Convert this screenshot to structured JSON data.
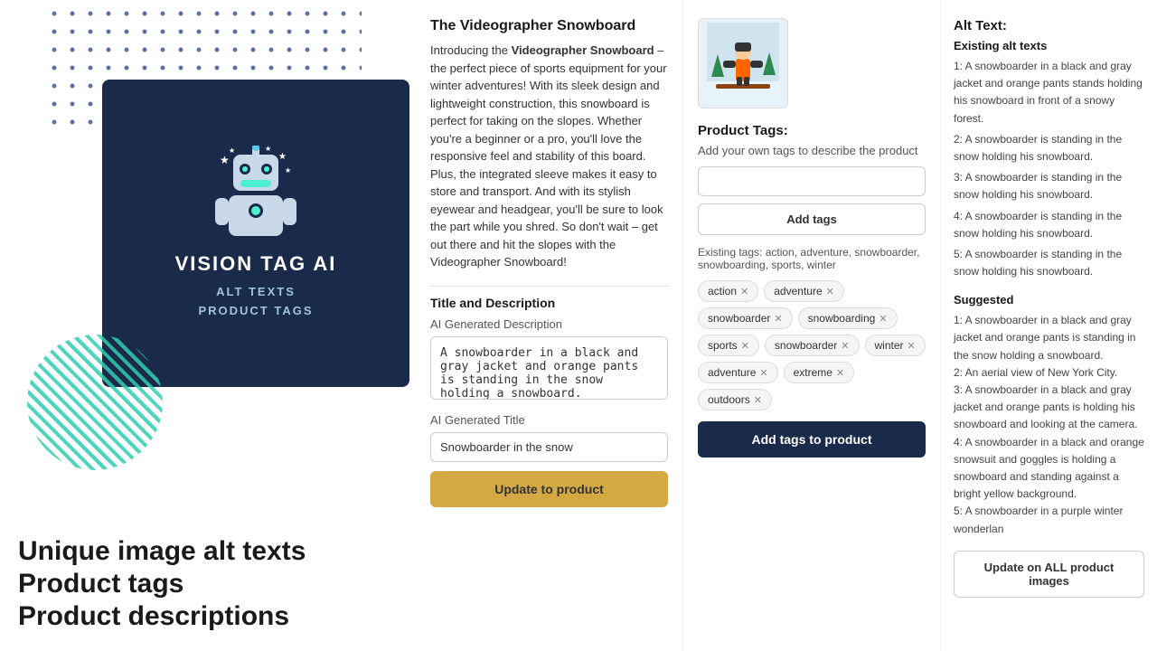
{
  "dots": {
    "color": "#1a2a6c"
  },
  "logo": {
    "title": "VISION TAG AI",
    "subtitle_line1": "ALT TEXTS",
    "subtitle_line2": "PRODUCT TAGS"
  },
  "bottom_text": {
    "line1": "Unique image alt texts",
    "line2": "Product tags",
    "line3": "Product descriptions"
  },
  "product": {
    "title": "The Videographer Snowboard",
    "description_intro": "Introducing the ",
    "description_bold": "Videographer Snowboard",
    "description_rest": " – the perfect piece of sports equipment for your winter adventures! With its sleek design and lightweight construction, this snowboard is perfect for taking on the slopes. Whether you're a beginner or a pro, you'll love the responsive feel and stability of this board. Plus, the integrated sleeve makes it easy to store and transport. And with its stylish eyewear and headgear, you'll be sure to look the part while you shred. So don't wait – get out there and hit the slopes with the Videographer Snowboard!"
  },
  "title_description_section": {
    "label": "Title and Description",
    "ai_desc_label": "AI Generated Description",
    "ai_desc_value": "A snowboarder in a black and gray jacket and orange pants is standing in the snow holding a snowboard.",
    "ai_title_label": "AI Generated Title",
    "ai_title_value": "Snowboarder in the snow",
    "update_button": "Update to product"
  },
  "tags": {
    "section_title": "Product Tags:",
    "description": "Add your own tags to describe the product",
    "input_placeholder": "",
    "add_button": "Add tags",
    "existing_label": "Existing tags: action, adventure, snowboarder, snowboarding, sports, winter",
    "chips": [
      {
        "label": "action"
      },
      {
        "label": "adventure"
      },
      {
        "label": "snowboarder"
      },
      {
        "label": "snowboarding"
      },
      {
        "label": "sports"
      },
      {
        "label": "snowboarder"
      },
      {
        "label": "winter"
      },
      {
        "label": "adventure"
      },
      {
        "label": "extreme"
      },
      {
        "label": "outdoors"
      }
    ],
    "add_to_product_button": "Add tags to product"
  },
  "alt_text": {
    "section_title": "Alt Text:",
    "existing_title": "Existing alt texts",
    "existing_items": [
      "1: A snowboarder in a black and gray jacket and orange pants stands holding his snowboard in front of a snowy forest.",
      "2: A snowboarder is standing in the snow holding his snowboard.",
      "3: A snowboarder is standing in the snow holding his snowboard.",
      "4: A snowboarder is standing in the snow holding his snowboard.",
      "5: A snowboarder is standing in the snow holding his snowboard."
    ],
    "suggested_title": "Suggested",
    "suggested_items": [
      "1: A snowboarder in a black and gray jacket and orange pants is standing in the snow holding a snowboard.",
      "2: An aerial view of New York City.",
      "3: A snowboarder in a black and gray jacket and orange pants is holding his snowboard and looking at the camera.",
      "4: A snowboarder in a black and orange snowsuit and goggles is holding a snowboard and standing against a bright yellow background.",
      "5: A snowboarder in a purple winter wonderlan"
    ],
    "update_all_button": "Update on ALL product images"
  }
}
